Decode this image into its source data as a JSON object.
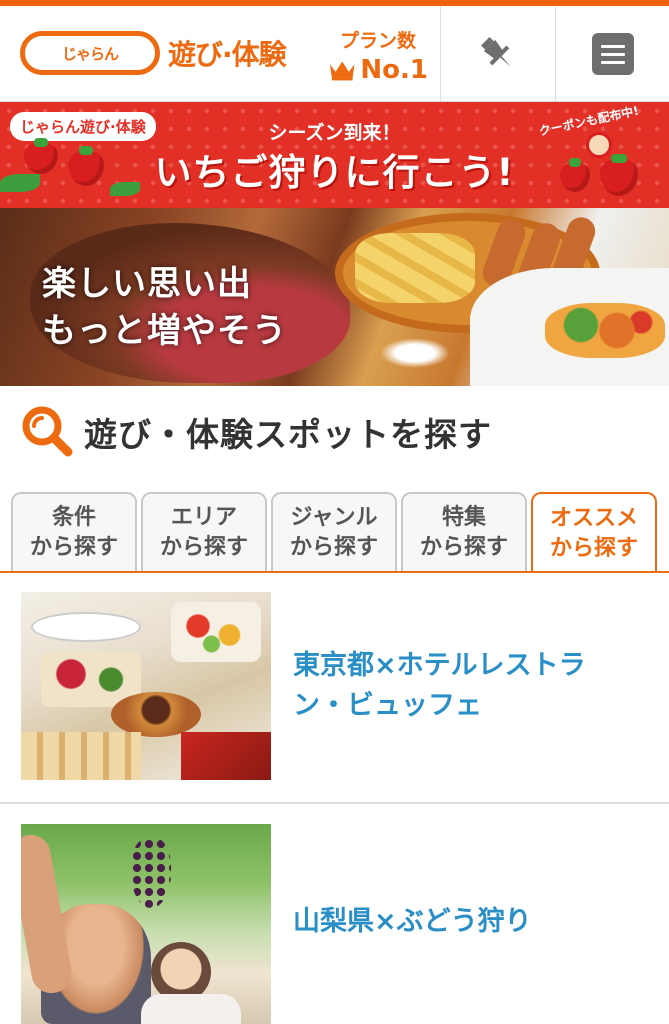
{
  "header": {
    "logo_small": "じゃらん",
    "logo_main": "遊び·体験",
    "plan_label": "プラン数",
    "plan_rank": "No.1"
  },
  "banner": {
    "logo": "じゃらん遊び·体験",
    "sub": "シーズン到来！",
    "main": "いちご狩りに行こう!",
    "coupon": "クーポンも配布中!"
  },
  "hero": {
    "line1": "楽しい思い出",
    "line2": "もっと増やそう"
  },
  "search": {
    "title": "遊び・体験スポットを探す"
  },
  "tabs": [
    {
      "line1": "条件",
      "line2": "から探す",
      "active": false
    },
    {
      "line1": "エリア",
      "line2": "から探す",
      "active": false
    },
    {
      "line1": "ジャンル",
      "line2": "から探す",
      "active": false
    },
    {
      "line1": "特集",
      "line2": "から探す",
      "active": false
    },
    {
      "line1": "オススメ",
      "line2": "から探す",
      "active": true
    }
  ],
  "items": [
    {
      "title": "東京都×ホテルレストラン・ビュッフェ"
    },
    {
      "title": "山梨県×ぶどう狩り"
    }
  ],
  "colors": {
    "brand": "#ee6a10",
    "banner_red": "#e33026",
    "link_blue": "#2a8fc6"
  }
}
